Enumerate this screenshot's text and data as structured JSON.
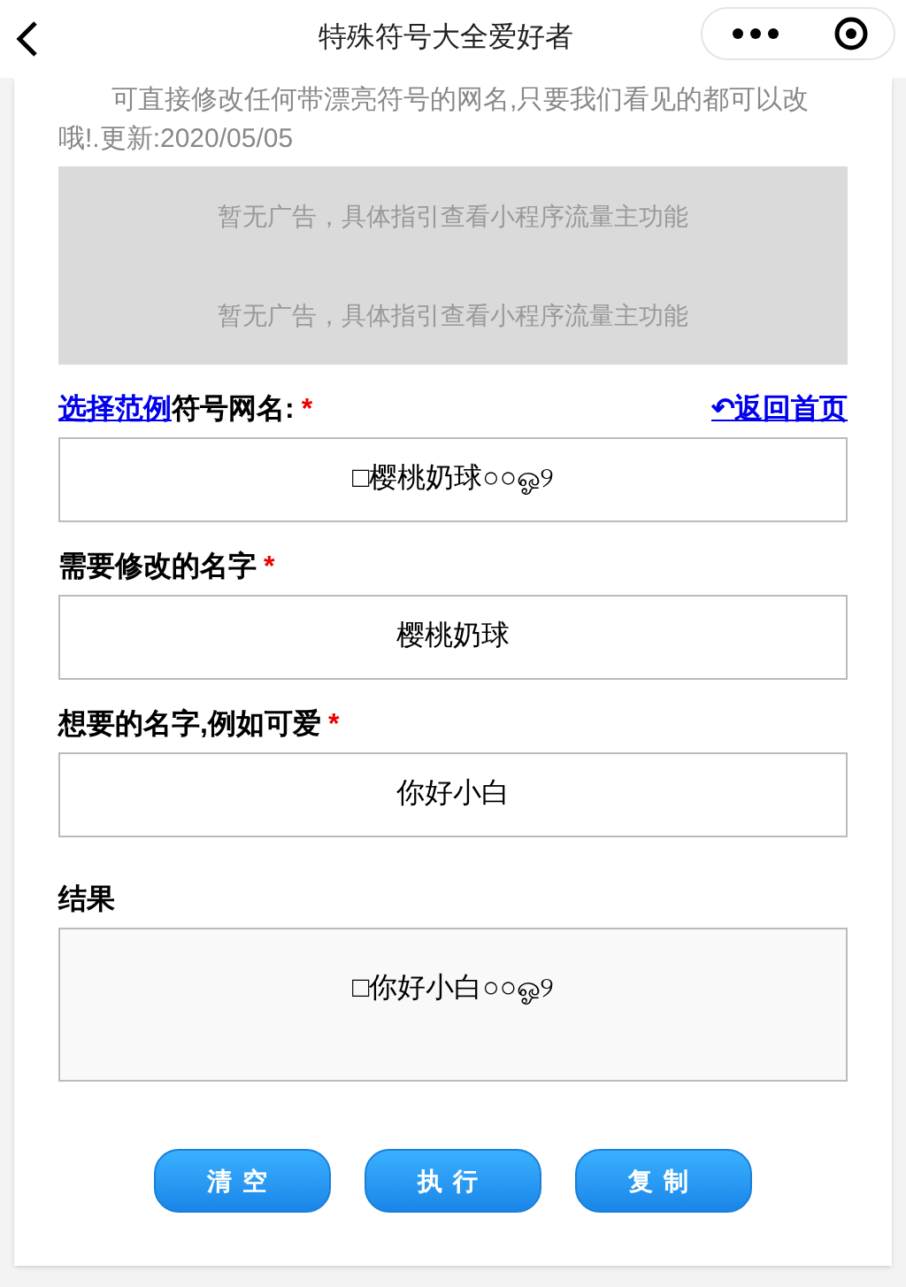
{
  "header": {
    "title": "特殊符号大全爱好者"
  },
  "intro": "可直接修改任何带漂亮符号的网名,只要我们看见的都可以改哦!.更新:2020/05/05",
  "ads": [
    "暂无广告，具体指引查看小程序流量主功能",
    "暂无广告，具体指引查看小程序流量主功能"
  ],
  "form": {
    "example_link": "选择范例",
    "home_link": "↶返回首页",
    "fields": [
      {
        "label": "符号网名:",
        "required_mark": "*",
        "value": "□樱桃奶球○○ஓ୨"
      },
      {
        "label": "需要修改的名字",
        "required_mark": "*",
        "value": "樱桃奶球"
      },
      {
        "label": "想要的名字,例如可爱",
        "required_mark": "*",
        "value": "你好小白"
      }
    ],
    "result": {
      "label": "结果",
      "value": "□你好小白○○ஓ୨"
    }
  },
  "buttons": [
    "清空",
    "执行",
    "复制"
  ]
}
